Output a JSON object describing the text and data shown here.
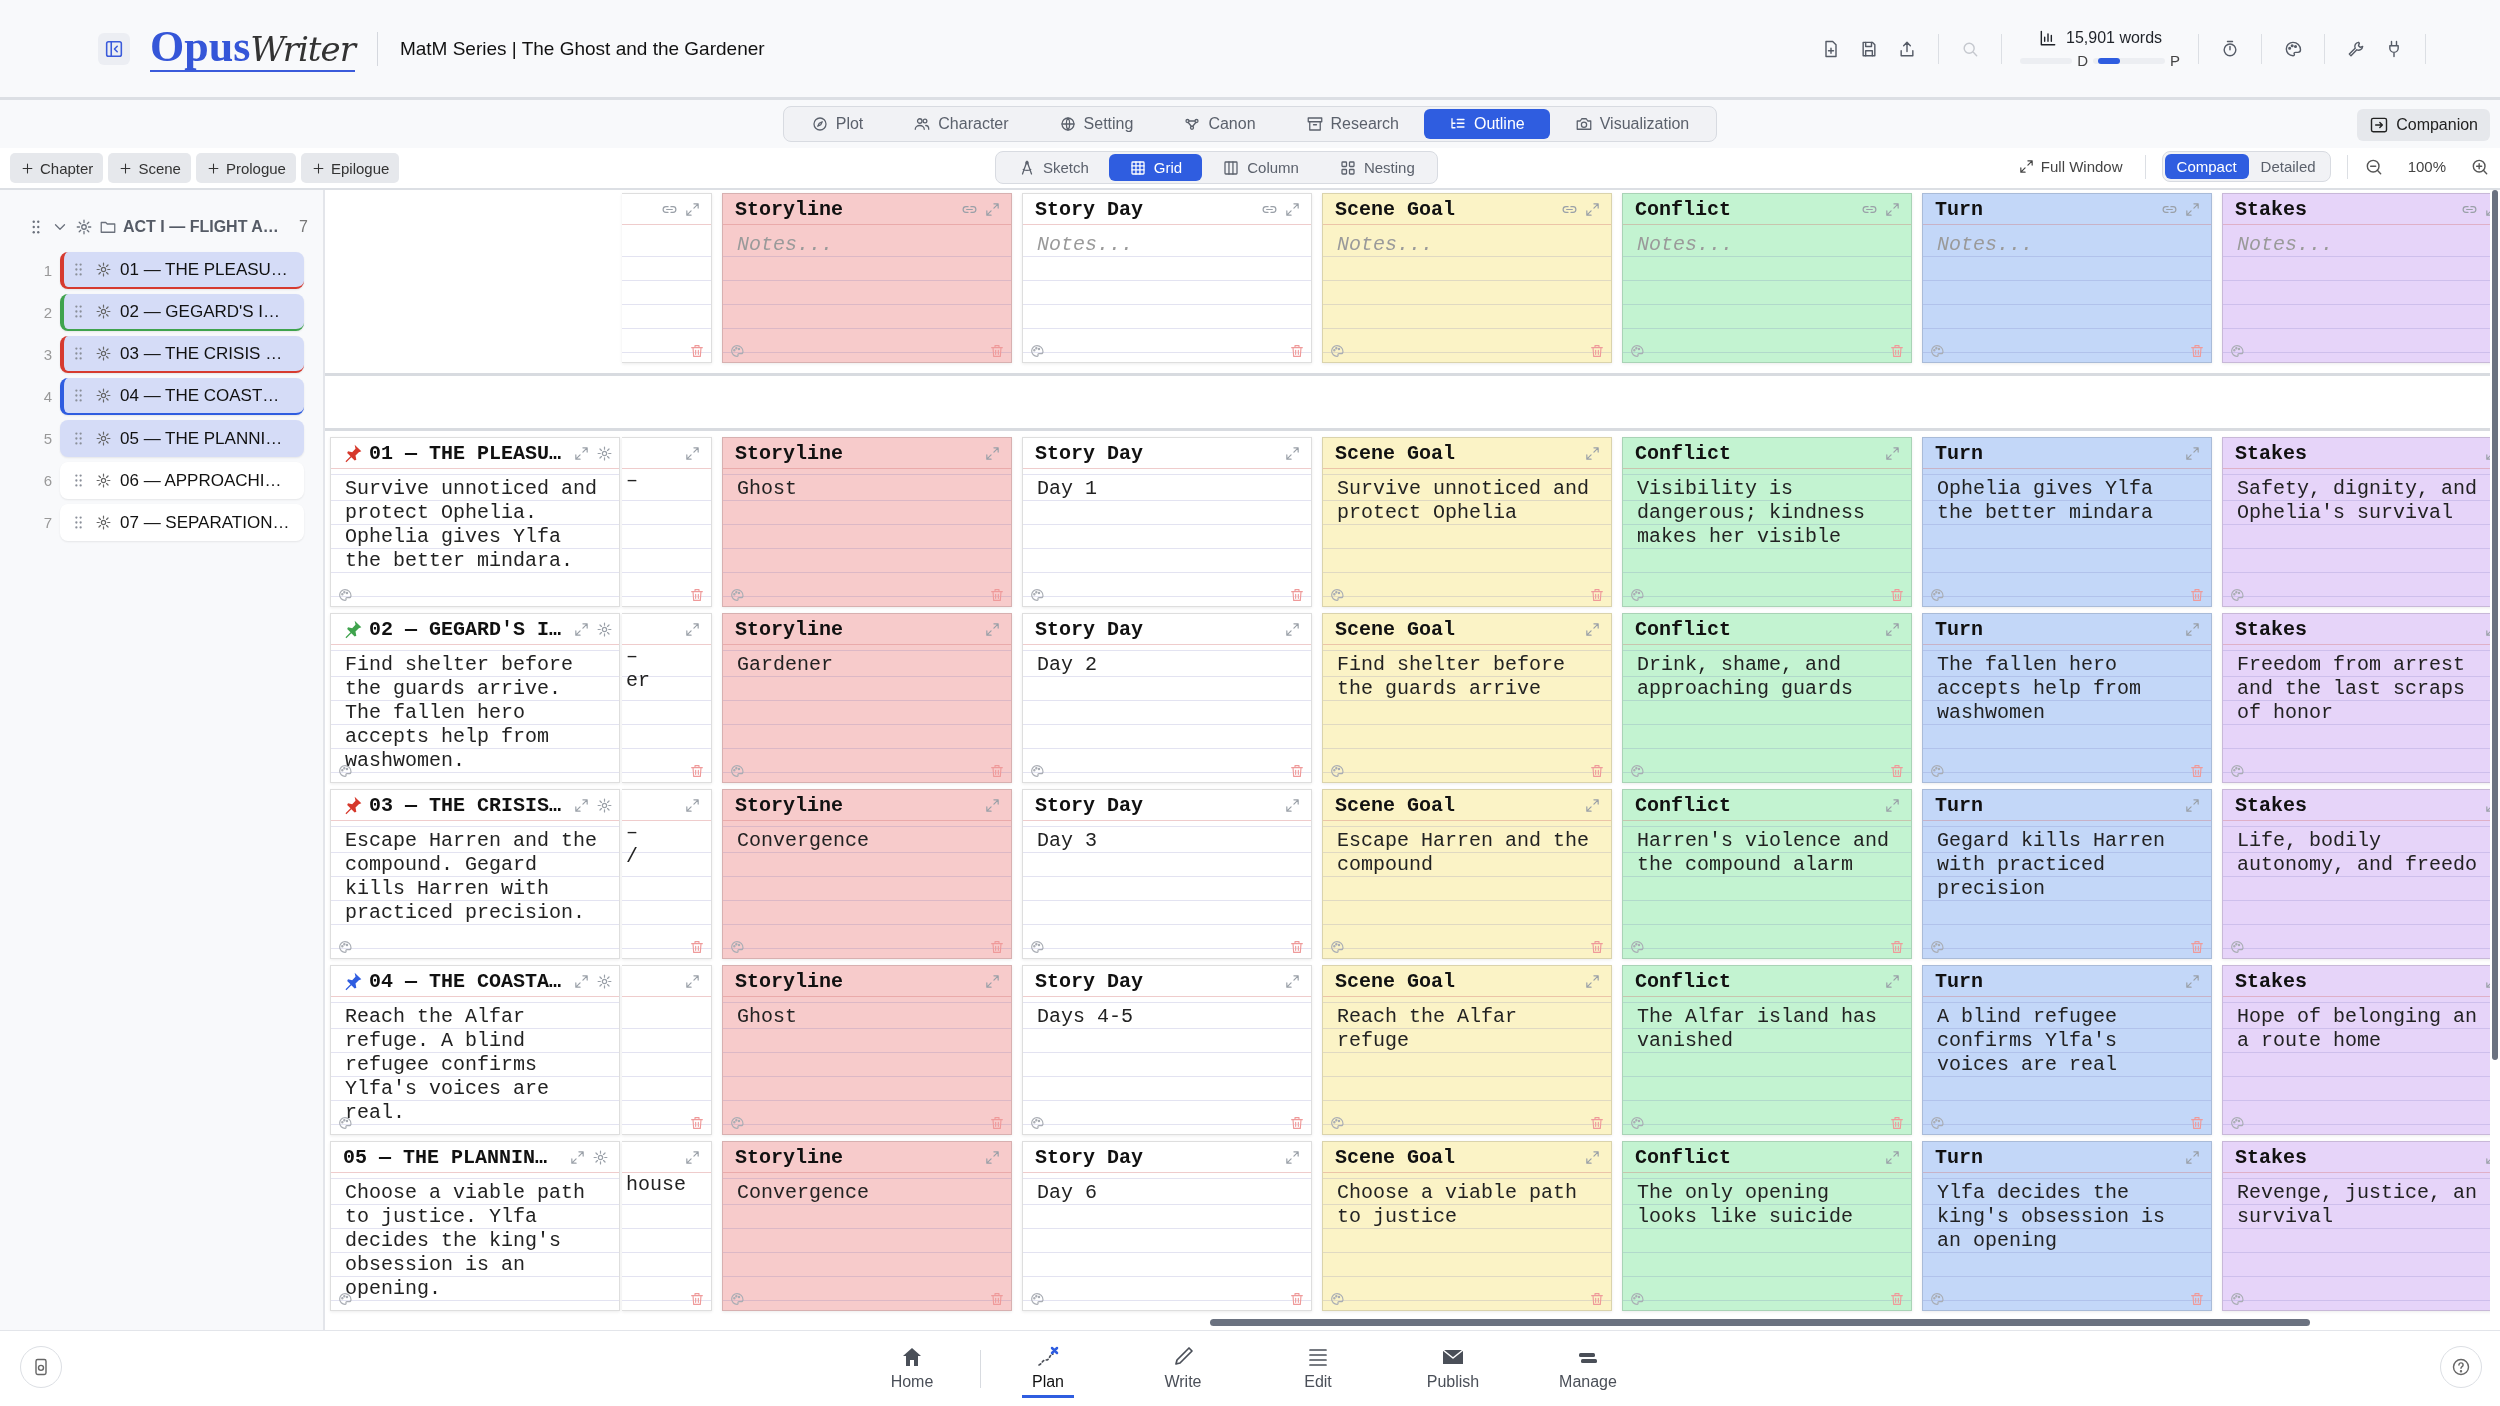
{
  "header": {
    "logo_bold": "Opus",
    "logo_script": "Writer",
    "title": "MatM Series | The Ghost and the Gardener",
    "word_count": "15,901 words",
    "progress": {
      "start": "D",
      "end": "P",
      "level": 0.1
    }
  },
  "mode_tabs": [
    {
      "label": "Plot",
      "selected": false
    },
    {
      "label": "Character",
      "selected": false
    },
    {
      "label": "Setting",
      "selected": false
    },
    {
      "label": "Canon",
      "selected": false
    },
    {
      "label": "Research",
      "selected": false
    },
    {
      "label": "Outline",
      "selected": true
    },
    {
      "label": "Visualization",
      "selected": false
    }
  ],
  "companion": "Companion",
  "add_buttons": [
    "Chapter",
    "Scene",
    "Prologue",
    "Epilogue"
  ],
  "view_tabs": [
    {
      "label": "Sketch",
      "selected": false
    },
    {
      "label": "Grid",
      "selected": true
    },
    {
      "label": "Column",
      "selected": false
    },
    {
      "label": "Nesting",
      "selected": false
    }
  ],
  "full_window": "Full Window",
  "density": [
    {
      "label": "Compact",
      "selected": true
    },
    {
      "label": "Detailed",
      "selected": false
    }
  ],
  "zoom": "100%",
  "sidebar": {
    "act": {
      "title": "ACT I — FLIGHT A…",
      "count": "7",
      "expanded": true
    },
    "scenes": [
      {
        "number": "1",
        "title": "01 — THE PLEASU…",
        "selected": true,
        "color": "#d63a2f"
      },
      {
        "number": "2",
        "title": "02 — GEGARD'S I…",
        "selected": true,
        "color": "#3fa34d"
      },
      {
        "number": "3",
        "title": "03 — THE CRISIS …",
        "selected": true,
        "color": "#d63a2f"
      },
      {
        "number": "4",
        "title": "04 — THE COAST…",
        "selected": true,
        "color": "#2f5de0"
      },
      {
        "number": "5",
        "title": "05 — THE PLANNI…",
        "selected": true
      },
      {
        "number": "6",
        "title": "06 — APPROACHI…",
        "selected": false
      },
      {
        "number": "7",
        "title": "07 — SEPARATION…",
        "selected": false
      }
    ]
  },
  "grid": {
    "columns": [
      {
        "title": "Storyline",
        "color": "#f7cbcb",
        "placeholder": "Notes..."
      },
      {
        "title": "Story Day",
        "color": "#ffffff",
        "placeholder": "Notes..."
      },
      {
        "title": "Scene Goal",
        "color": "#fbf3c6",
        "placeholder": "Notes..."
      },
      {
        "title": "Conflict",
        "color": "#c3f3d1",
        "placeholder": "Notes..."
      },
      {
        "title": "Turn",
        "color": "#c3d7f8",
        "placeholder": "Notes..."
      },
      {
        "title": "Stakes",
        "color": "#e6d4f9",
        "placeholder": "Notes..."
      }
    ],
    "rows": [
      {
        "title": "01 — THE PLEASU…",
        "color": "#d6392c",
        "summary": "Survive unnoticed and protect Ophelia. Ophelia gives Ylfa the better mindara.",
        "peek_lines": [
          "–"
        ],
        "cells": [
          {
            "title": "Storyline",
            "text": "Ghost"
          },
          {
            "title": "Story Day",
            "text": "Day 1"
          },
          {
            "title": "Scene Goal",
            "text": "Survive unnoticed and protect Ophelia"
          },
          {
            "title": "Conflict",
            "text": "Visibility is dangerous; kindness makes her visible"
          },
          {
            "title": "Turn",
            "text": "Ophelia gives Ylfa the better mindara"
          },
          {
            "title": "Stakes",
            "text": "Safety, dignity, and Ophelia's survival"
          }
        ]
      },
      {
        "title": "02 — GEGARD'S I…",
        "color": "#3fa34d",
        "summary": "Find shelter before the guards arrive. The fallen hero accepts help from washwomen.",
        "peek_lines": [
          "–",
          "er"
        ],
        "cells": [
          {
            "title": "Storyline",
            "text": "Gardener"
          },
          {
            "title": "Story Day",
            "text": "Day 2"
          },
          {
            "title": "Scene Goal",
            "text": "Find shelter before the guards arrive"
          },
          {
            "title": "Conflict",
            "text": "Drink, shame, and approaching guards"
          },
          {
            "title": "Turn",
            "text": "The fallen hero accepts help from washwomen"
          },
          {
            "title": "Stakes",
            "text": "Freedom from arrest and the last scraps of honor"
          }
        ]
      },
      {
        "title": "03 — THE CRISIS…",
        "color": "#d6392c",
        "summary": "Escape Harren and the compound. Gegard kills Harren with practiced precision.",
        "peek_lines": [
          "–",
          "/"
        ],
        "cells": [
          {
            "title": "Storyline",
            "text": "Convergence"
          },
          {
            "title": "Story Day",
            "text": "Day 3"
          },
          {
            "title": "Scene Goal",
            "text": "Escape Harren and the compound"
          },
          {
            "title": "Conflict",
            "text": "Harren's violence and the compound alarm"
          },
          {
            "title": "Turn",
            "text": "Gegard kills Harren with practiced precision"
          },
          {
            "title": "Stakes",
            "text": "Life, bodily autonomy, and freedo"
          }
        ]
      },
      {
        "title": "04 — THE COASTA…",
        "color": "#2f5de0",
        "summary": "Reach the Alfar refuge. A blind refugee confirms Ylfa's voices are real.",
        "cells": [
          {
            "title": "Storyline",
            "text": "Ghost"
          },
          {
            "title": "Story Day",
            "text": "Days 4-5"
          },
          {
            "title": "Scene Goal",
            "text": "Reach the Alfar refuge"
          },
          {
            "title": "Conflict",
            "text": "The Alfar island has vanished"
          },
          {
            "title": "Turn",
            "text": "A blind refugee confirms Ylfa's voices are real"
          },
          {
            "title": "Stakes",
            "text": "Hope of belonging an a route home"
          }
        ]
      },
      {
        "title": "05 — THE PLANNIN…",
        "summary": "Choose a viable path to justice. Ylfa decides the king's obsession is an opening.",
        "peek_lines": [
          "house"
        ],
        "cells": [
          {
            "title": "Storyline",
            "text": "Convergence"
          },
          {
            "title": "Story Day",
            "text": "Day 6"
          },
          {
            "title": "Scene Goal",
            "text": "Choose a viable path to justice"
          },
          {
            "title": "Conflict",
            "text": "The only opening looks like suicide"
          },
          {
            "title": "Turn",
            "text": "Ylfa decides the king's obsession is an opening"
          },
          {
            "title": "Stakes",
            "text": "Revenge, justice, an survival"
          }
        ]
      }
    ]
  },
  "bottom_nav": [
    {
      "label": "Home",
      "selected": false
    },
    {
      "label": "Plan",
      "selected": true
    },
    {
      "label": "Write",
      "selected": false
    },
    {
      "label": "Edit",
      "selected": false
    },
    {
      "label": "Publish",
      "selected": false
    },
    {
      "label": "Manage",
      "selected": false
    }
  ]
}
